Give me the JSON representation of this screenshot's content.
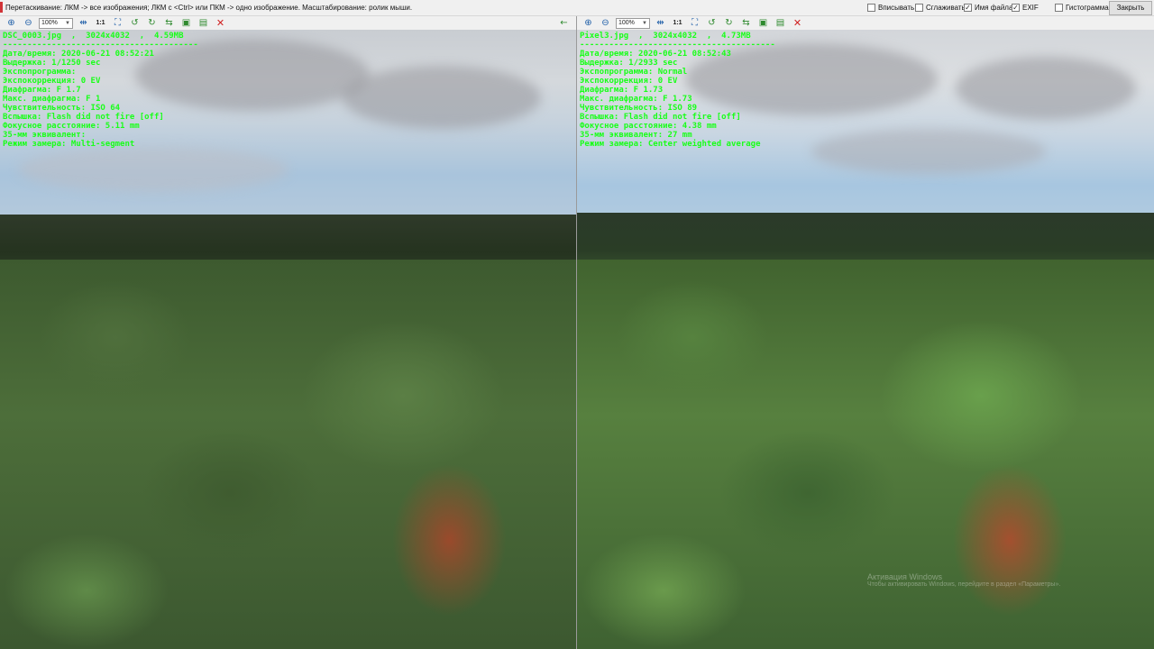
{
  "topbar": {
    "hint": "Перетаскивание: ЛКМ -> все изображения; ЛКМ с <Ctrl> или ПКМ -> одно изображение. Масштабирование: ролик мыши.",
    "options": [
      {
        "label": "Вписывать",
        "checked": false
      },
      {
        "label": "Сглаживать",
        "checked": false
      },
      {
        "label": "Имя файла",
        "checked": true
      },
      {
        "label": "EXIF",
        "checked": true
      },
      {
        "label": "Гистограмма",
        "checked": false
      }
    ],
    "close_label": "Закрыть"
  },
  "toolbar": {
    "zoom_value": "100%",
    "one_to_one": "1:1"
  },
  "panes": [
    {
      "header": "DSC_0003.jpg  ,  3024x4032  ,  4.59MB",
      "separator": "----------------------------------------",
      "exif": [
        "Дата/время: 2020-06-21 08:52:21",
        "Выдержка: 1/1250 sec",
        "Экспопрограмма:",
        "Экспокоррекция: 0 EV",
        "Диафрагма: F 1.7",
        "Макс. диафрагма: F 1",
        "Чувствительность: ISO 64",
        "Вспышка: Flash did not fire [off]",
        "Фокусное расстояние: 5.11 mm",
        "35-мм эквивалент:",
        "Режим замера: Multi-segment"
      ]
    },
    {
      "header": "Pixel3.jpg  ,  3024x4032  ,  4.73MB",
      "separator": "----------------------------------------",
      "exif": [
        "Дата/время: 2020-06-21 08:52:43",
        "Выдержка: 1/2933 sec",
        "Экспопрограмма: Normal",
        "Экспокоррекция: 0 EV",
        "Диафрагма: F 1.73",
        "Макс. диафрагма: F 1.73",
        "Чувствительность: ISO 89",
        "Вспышка: Flash did not fire [off]",
        "Фокусное расстояние: 4.38 mm",
        "35-мм эквивалент: 27 mm",
        "Режим замера: Center weighted average"
      ]
    }
  ],
  "watermark": {
    "line1": "Активация Windows",
    "line2": "Чтобы активировать Windows, перейдите в раздел «Параметры»."
  },
  "colors": {
    "exif_text": "#19ff19",
    "close_icon": "#d02020",
    "zoom_icons": "#1f5fa8",
    "nav_icons": "#2f8a2f"
  }
}
